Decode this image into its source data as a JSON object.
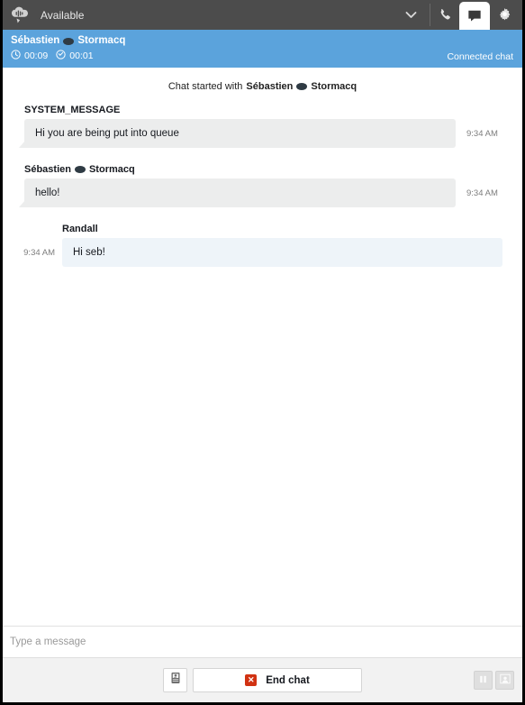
{
  "topbar": {
    "logo_icon": "connect-cloud-logo-icon",
    "status_label": "Available",
    "chevron_icon": "chevron-down-icon",
    "phone_icon": "phone-icon",
    "chat_icon": "chat-bubble-icon",
    "settings_icon": "gear-icon"
  },
  "contact": {
    "name_first": "Sébastien",
    "name_last": "Stormacq",
    "clock_icon": "clock-icon",
    "timer_total": "00:09",
    "hold_icon": "timer-icon",
    "timer_connected": "00:01",
    "connection_status": "Connected chat",
    "bar_color": "#5ba3dc"
  },
  "chat": {
    "started_prefix": "Chat started with",
    "started_name_first": "Sébastien",
    "started_name_last": "Stormacq",
    "messages": [
      {
        "author": "SYSTEM_MESSAGE",
        "text": "Hi you are being put into queue",
        "time": "9:34 AM",
        "direction": "in",
        "redacted_name": false
      },
      {
        "author_first": "Sébastien",
        "author_last": "Stormacq",
        "text": "hello!",
        "time": "9:34 AM",
        "direction": "in",
        "redacted_name": true
      },
      {
        "author": "Randall",
        "text": "Hi seb!",
        "time": "9:34 AM",
        "direction": "out",
        "redacted_name": false
      }
    ]
  },
  "composer": {
    "placeholder": "Type a message",
    "value": ""
  },
  "actions": {
    "quick_connect_icon": "quick-connect-icon",
    "end_chat_label": "End chat",
    "end_chat_icon": "end-call-x-icon",
    "end_chat_accent": "#d13212",
    "pause_icon": "pause-icon",
    "agent_icon": "agent-person-icon"
  }
}
